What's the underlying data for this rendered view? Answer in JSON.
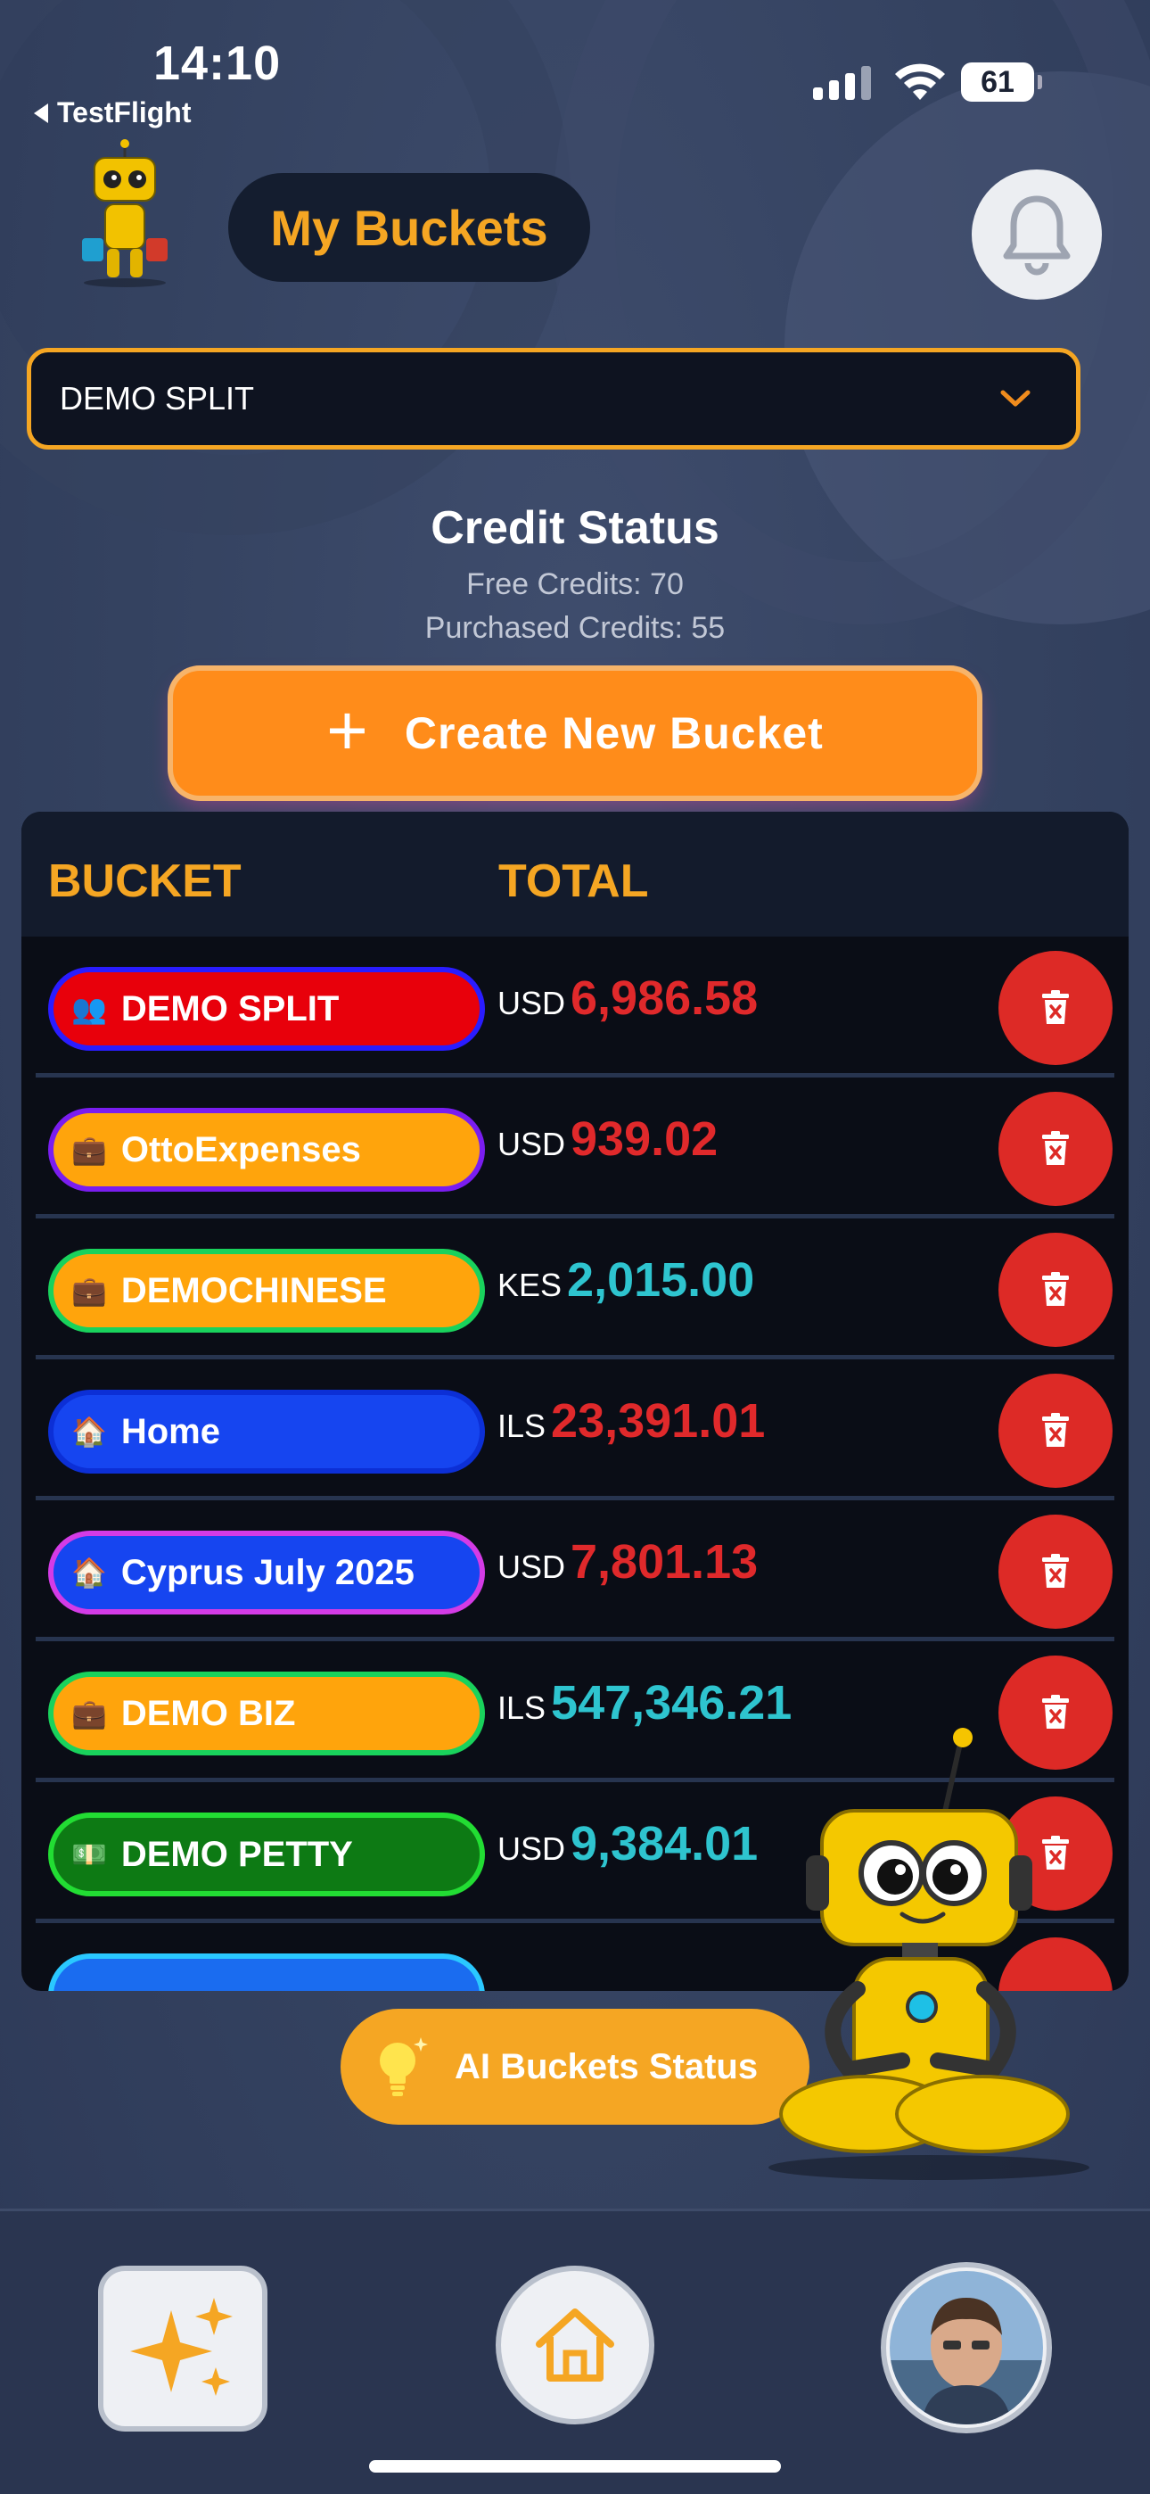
{
  "status_bar": {
    "time": "14:10",
    "back_app": "TestFlight",
    "battery": "61"
  },
  "header": {
    "title": "My Buckets",
    "bell_icon": "bell-icon"
  },
  "bucket_select": {
    "value": "DEMO SPLIT"
  },
  "credits": {
    "heading": "Credit Status",
    "free": "Free Credits: 70",
    "purchased": "Purchased Credits: 55"
  },
  "create_button": {
    "label": "Create New Bucket"
  },
  "table": {
    "col_bucket": "BUCKET",
    "col_total": "TOTAL",
    "rows": [
      {
        "name": "DEMO SPLIT",
        "icon": "👥",
        "currency": "USD",
        "amount": "6,986.58",
        "amount_color": "red",
        "pill_bg": "#e8000b",
        "pill_border": "#2a1cff"
      },
      {
        "name": "OttoExpenses",
        "icon": "💼",
        "currency": "USD",
        "amount": "939.02",
        "amount_color": "red",
        "pill_bg": "#ffa40c",
        "pill_border": "#7a1df0"
      },
      {
        "name": "DEMOCHINESE",
        "icon": "💼",
        "currency": "KES",
        "amount": "2,015.00",
        "amount_color": "teal",
        "pill_bg": "#ffa40c",
        "pill_border": "#19d25c"
      },
      {
        "name": "Home",
        "icon": "🏠",
        "currency": "ILS",
        "amount": "23,391.01",
        "amount_color": "red",
        "pill_bg": "#1645f0",
        "pill_border": "#0c2fd6"
      },
      {
        "name": "Cyprus July 2025",
        "icon": "🏠",
        "currency": "USD",
        "amount": "7,801.13",
        "amount_color": "red",
        "pill_bg": "#1645f0",
        "pill_border": "#d43be6"
      },
      {
        "name": "DEMO BIZ",
        "icon": "💼",
        "currency": "ILS",
        "amount": "547,346.21",
        "amount_color": "teal",
        "pill_bg": "#ffa40c",
        "pill_border": "#19d25c"
      },
      {
        "name": "DEMO PETTY",
        "icon": "💵",
        "currency": "USD",
        "amount": "9,384.01",
        "amount_color": "teal",
        "pill_bg": "#0d7a14",
        "pill_border": "#22dd33"
      }
    ]
  },
  "ai_button": {
    "label": "AI Buckets Status"
  },
  "colors": {
    "accent": "#f5a623",
    "delete": "#dd2a26",
    "negative": "#e0292b",
    "positive": "#2ec4cf"
  }
}
